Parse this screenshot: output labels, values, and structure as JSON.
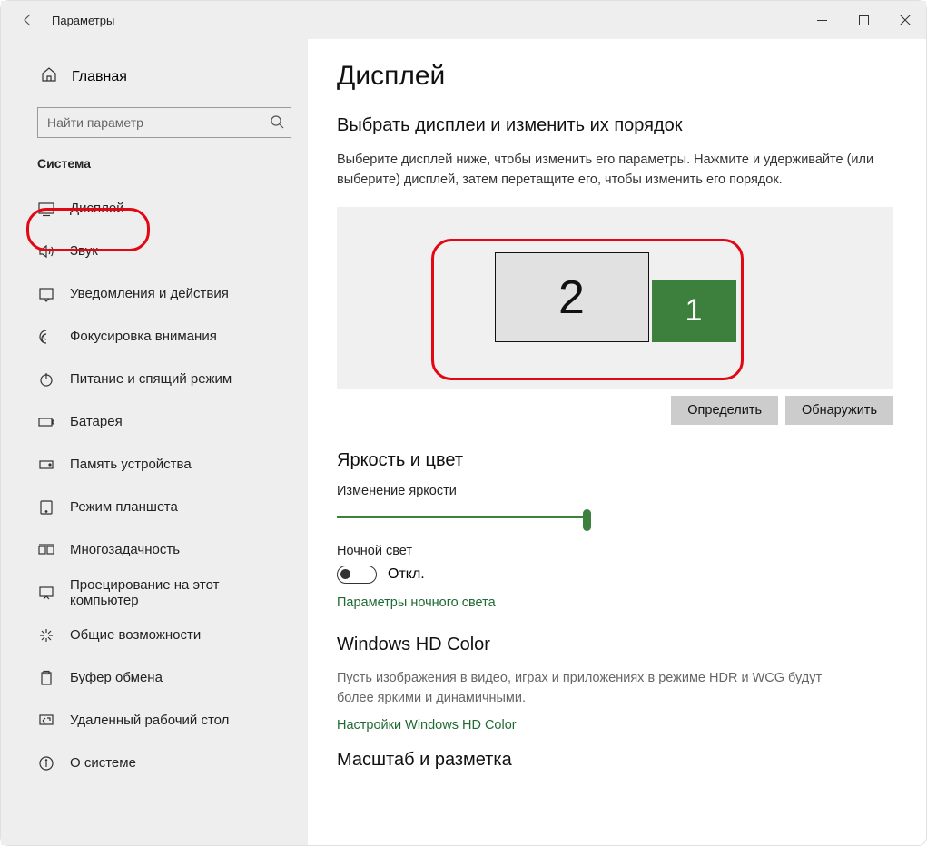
{
  "window": {
    "title": "Параметры"
  },
  "home": {
    "label": "Главная"
  },
  "search": {
    "placeholder": "Найти параметр"
  },
  "section": "Система",
  "nav": [
    {
      "id": "display",
      "label": "Дисплей"
    },
    {
      "id": "sound",
      "label": "Звук"
    },
    {
      "id": "notifications",
      "label": "Уведомления и действия"
    },
    {
      "id": "focus",
      "label": "Фокусировка внимания"
    },
    {
      "id": "power",
      "label": "Питание и спящий режим"
    },
    {
      "id": "battery",
      "label": "Батарея"
    },
    {
      "id": "storage",
      "label": "Память устройства"
    },
    {
      "id": "tablet",
      "label": "Режим планшета"
    },
    {
      "id": "multitask",
      "label": "Многозадачность"
    },
    {
      "id": "projecting",
      "label": "Проецирование на этот компьютер"
    },
    {
      "id": "shared",
      "label": "Общие возможности"
    },
    {
      "id": "clipboard",
      "label": "Буфер обмена"
    },
    {
      "id": "remote",
      "label": "Удаленный рабочий стол"
    },
    {
      "id": "about",
      "label": "О системе"
    }
  ],
  "main": {
    "title": "Дисплей",
    "arrange_title": "Выбрать дисплеи и изменить их порядок",
    "arrange_desc": "Выберите дисплей ниже, чтобы изменить его параметры. Нажмите и удерживайте (или выберите) дисплей, затем перетащите его, чтобы изменить его порядок.",
    "monitor2": "2",
    "monitor1": "1",
    "identify": "Определить",
    "detect": "Обнаружить",
    "brightness_title": "Яркость и цвет",
    "brightness_label": "Изменение яркости",
    "nightlight_label": "Ночной свет",
    "toggle_off": "Откл.",
    "nightlight_link": "Параметры ночного света",
    "hdcolor_title": "Windows HD Color",
    "hdcolor_desc": "Пусть изображения в видео, играх и приложениях в режиме HDR и WCG будут более яркими и динамичными.",
    "hdcolor_link": "Настройки Windows HD Color",
    "scale_title": "Масштаб и разметка"
  }
}
